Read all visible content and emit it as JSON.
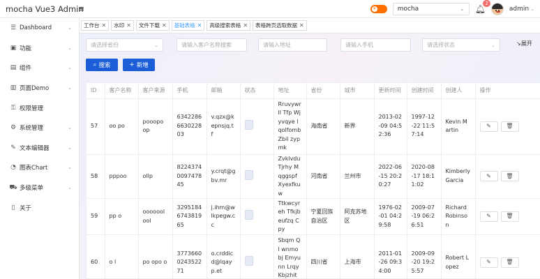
{
  "header": {
    "title": "mocha Vue3 Admin",
    "collapse_icon": "menu-icon",
    "theme_select_value": "mocha",
    "notification_count": "2",
    "user_name": "admin"
  },
  "sidebar": {
    "items": [
      {
        "label": "Dashboard",
        "icon": "dashboard-icon",
        "glyph": "☰",
        "chevron": true
      },
      {
        "label": "功能",
        "icon": "function-icon",
        "glyph": "▣",
        "chevron": true
      },
      {
        "label": "组件",
        "icon": "component-icon",
        "glyph": "▤",
        "chevron": true
      },
      {
        "label": "页面Demo",
        "icon": "page-icon",
        "glyph": "▥",
        "chevron": true
      },
      {
        "label": "权限管理",
        "icon": "lock-icon",
        "glyph": "⚿",
        "chevron": false
      },
      {
        "label": "系统管理",
        "icon": "gear-icon",
        "glyph": "⚙",
        "chevron": true
      },
      {
        "label": "文本编辑器",
        "icon": "editor-icon",
        "glyph": "✎",
        "chevron": true
      },
      {
        "label": "图表Chart",
        "icon": "chart-icon",
        "glyph": "◔",
        "chevron": true
      },
      {
        "label": "多级菜单",
        "icon": "cart-icon",
        "glyph": "⛟",
        "chevron": true
      },
      {
        "label": "关于",
        "icon": "phone-icon",
        "glyph": "▯",
        "chevron": false
      }
    ]
  },
  "tabs": [
    {
      "label": "工作台",
      "active": false
    },
    {
      "label": "水印",
      "active": false
    },
    {
      "label": "文件下载",
      "active": false
    },
    {
      "label": "基础表格",
      "active": true
    },
    {
      "label": "高级搜索表格",
      "active": false
    },
    {
      "label": "表格跨页选取数据",
      "active": false
    }
  ],
  "filters": {
    "province_placeholder": "请选择省份",
    "customer_placeholder": "请输入客户名称搜索",
    "address_placeholder": "请输入地址",
    "phone_placeholder": "请输入手机",
    "status_placeholder": "请选择状态",
    "expand_label": "展开",
    "search_label": "搜索",
    "add_label": "新增"
  },
  "table": {
    "columns": [
      "ID",
      "客户名称",
      "客户来源",
      "手机",
      "邮箱",
      "状态",
      "地址",
      "省份",
      "城市",
      "更新时间",
      "创建时间",
      "创建人",
      "操作"
    ],
    "rows": [
      {
        "id": "57",
        "name": "oo po",
        "source": "pooopo op",
        "phone": "6342286663022803",
        "email": "v.qzx@kepnsjq.tf",
        "address": "Rruvywrll Tfp Wjyvqye lqolfomb Zbil zypmk",
        "province": "海南省",
        "city": "新界",
        "updated": "2013-02-09 04:52:36",
        "created": "1997-12-22 11:57:14",
        "creator": "Kevin Martin"
      },
      {
        "id": "58",
        "name": "pppoo",
        "source": "ollp",
        "phone": "8224374009747845",
        "email": "y.crqt@gbv.mr",
        "address": "Zvklvdu Tjrhy Mqggspf Xyexfkuw",
        "province": "河南省",
        "city": "兰州市",
        "updated": "2022-06-15 20:20:27",
        "created": "2020-08-17 18:11:02",
        "creator": "Kimberly Garcia"
      },
      {
        "id": "59",
        "name": "pp o",
        "source": "oooooolool",
        "phone": "3295184674381965",
        "email": "j.ihm@wlkpegw.cc",
        "address": "Ttkwcyreh Tfkjbeufzq Cpy",
        "province": "宁夏回族自治区",
        "city": "阿克苏地区",
        "updated": "1976-02-01 04:29:58",
        "created": "2009-07-19 06:26:51",
        "creator": "Richard Robinson"
      },
      {
        "id": "60",
        "name": "o l",
        "source": "po opo o",
        "phone": "3773660024352271",
        "email": "o.crddic d@lqayp.et",
        "address": "Sbqm Ql wnmobj Emyunn Lrqy Kbjzhit Xrzlr",
        "province": "四川省",
        "city": "上海市",
        "updated": "2011-01-26 09:34:00",
        "created": "2009-09-20 19:25:57",
        "creator": "Robert Lopez"
      }
    ],
    "edit_icon": "edit-icon",
    "delete_icon": "delete-icon"
  }
}
